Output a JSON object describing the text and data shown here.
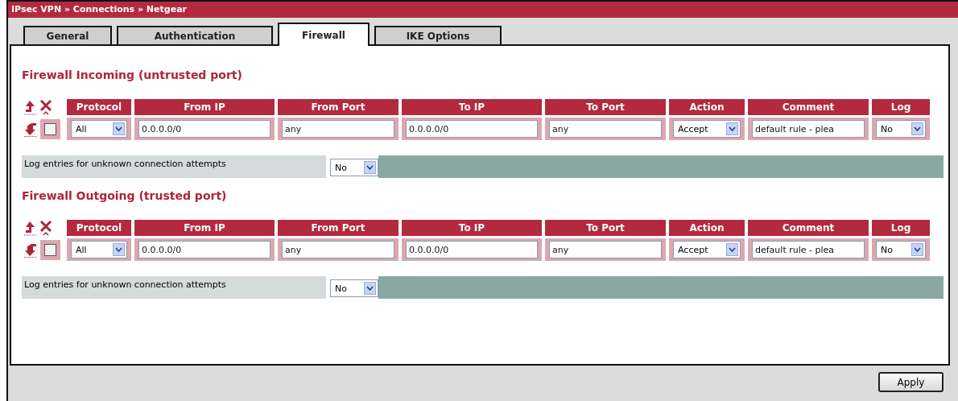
{
  "title": "IPsec VPN » Connections » Netgear",
  "tabs": [
    {
      "label": "General",
      "selected": false
    },
    {
      "label": "Authentication",
      "selected": false
    },
    {
      "label": "Firewall",
      "selected": true
    },
    {
      "label": "IKE Options",
      "selected": false
    }
  ],
  "sections": [
    {
      "title": "Firewall Incoming (untrusted port)",
      "columns": [
        "Protocol",
        "From IP",
        "From Port",
        "To IP",
        "To Port",
        "Action",
        "Comment",
        "Log"
      ],
      "rows": [
        {
          "checked": false,
          "protocol": "All",
          "from_ip": "0.0.0.0/0",
          "from_port": "any",
          "to_ip": "0.0.0.0/0",
          "to_port": "any",
          "action": "Accept",
          "comment": "default rule - plea",
          "log": "No"
        }
      ],
      "log_unknown": {
        "label": "Log entries for unknown connection attempts",
        "value": "No"
      }
    },
    {
      "title": "Firewall Outgoing (trusted port)",
      "columns": [
        "Protocol",
        "From IP",
        "From Port",
        "To IP",
        "To Port",
        "Action",
        "Comment",
        "Log"
      ],
      "rows": [
        {
          "checked": false,
          "protocol": "All",
          "from_ip": "0.0.0.0/0",
          "from_port": "any",
          "to_ip": "0.0.0.0/0",
          "to_port": "any",
          "action": "Accept",
          "comment": "default rule - plea",
          "log": "No"
        }
      ],
      "log_unknown": {
        "label": "Log entries for unknown connection attempts",
        "value": "No"
      }
    }
  ],
  "apply_button": "Apply"
}
